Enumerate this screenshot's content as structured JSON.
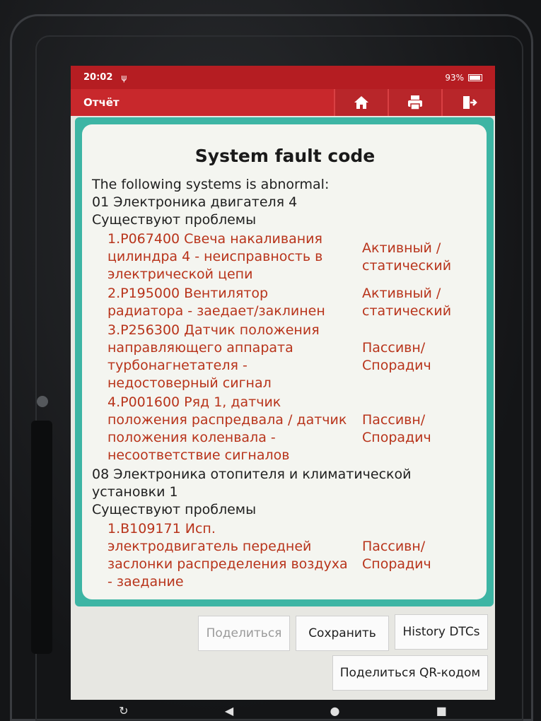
{
  "status": {
    "time": "20:02",
    "battery": "93%"
  },
  "header": {
    "title": "Отчёт"
  },
  "report": {
    "heading": "System fault code",
    "intro": "The following systems is abnormal:",
    "systems": [
      {
        "name": "01 Электроника двигателя 4",
        "state": "Существуют проблемы",
        "faults": [
          {
            "code": "1.P067400 Свеча накаливания цилиндра 4 - неисправность в электрической цепи",
            "status": "Активный / статический"
          },
          {
            "code": "2.P195000 Вентилятор радиатора - заедает/заклинен",
            "status": "Активный / статический"
          },
          {
            "code": "3.P256300 Датчик положения направляющего аппарата турбонагнетателя - недостоверный сигнал",
            "status": "Пассивн/ Спорадич"
          },
          {
            "code": "4.P001600 Ряд 1, датчик положения распредвала / датчик положения коленвала - несоответствие сигналов",
            "status": "Пассивн/ Спорадич"
          }
        ]
      },
      {
        "name": "08 Электроника отопителя и климатической установки 1",
        "state": "Существуют проблемы",
        "faults": [
          {
            "code": "1.B109171 Исп. электродвигатель передней заслонки распределения воздуха - заедание",
            "status": "Пассивн/ Спорадич"
          }
        ]
      }
    ]
  },
  "buttons": {
    "share": "Поделиться",
    "save": "Сохранить",
    "history": "History DTCs",
    "share_qr": "Поделиться QR-кодом"
  },
  "colors": {
    "header": "#c8282c",
    "accent": "#3db5a4",
    "fault_text": "#b8341b"
  }
}
